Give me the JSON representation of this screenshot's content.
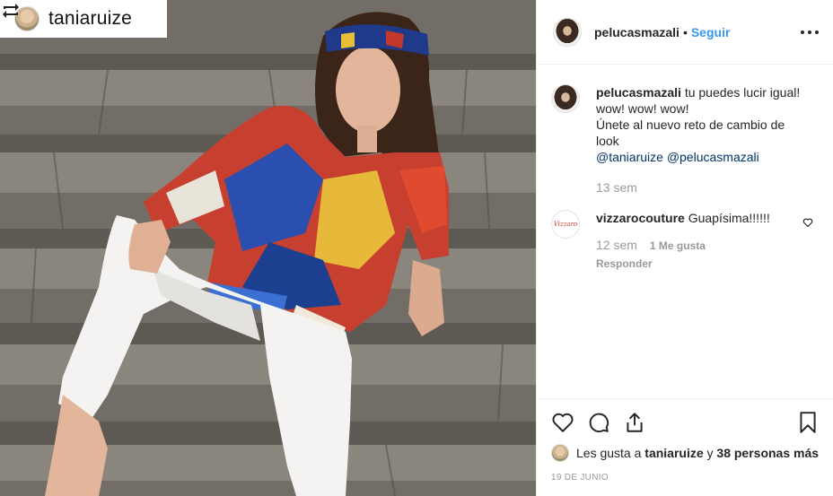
{
  "repost": {
    "icon": "repost-icon",
    "username": "taniaruize"
  },
  "photo": {
    "description_icon": "post-photo"
  },
  "header": {
    "username": "pelucasmazali",
    "separator": "•",
    "follow_label": "Seguir",
    "more_icon": "more-options-icon"
  },
  "caption": {
    "username": "pelucasmazali",
    "text_line1": "tu puedes lucir igual! wow! wow! wow!",
    "text_line2": "Únete al nuevo reto de cambio de look",
    "mention1": "@taniaruize",
    "mention2": "@pelucasmazali",
    "time": "13 sem"
  },
  "comment": {
    "username": "vizzarocouture",
    "avatar_text": "Vizzaro",
    "text": "Guapísima!!!!!!",
    "time": "12 sem",
    "likes": "1 Me gusta",
    "reply_label": "Responder"
  },
  "actions": {
    "like_icon": "heart-icon",
    "comment_icon": "comment-icon",
    "share_icon": "share-icon",
    "save_icon": "bookmark-icon"
  },
  "likes": {
    "prefix": "Les gusta a",
    "user": "taniaruize",
    "middle": "y",
    "others": "38 personas más"
  },
  "date": "19 DE JUNIO"
}
